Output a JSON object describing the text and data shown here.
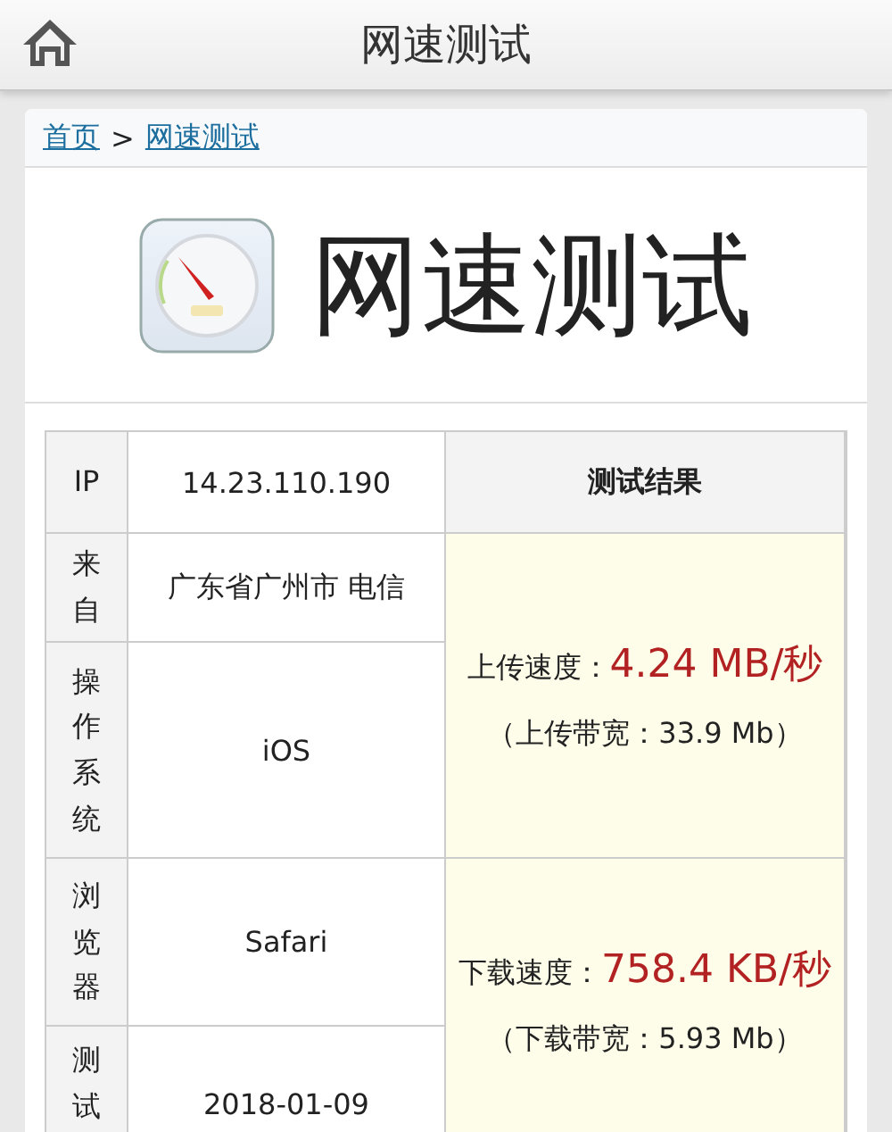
{
  "header": {
    "title": "网速测试"
  },
  "breadcrumb": {
    "links": [
      {
        "label": "首页"
      },
      {
        "label": "网速测试"
      }
    ],
    "separator": ">"
  },
  "hero": {
    "title": "网速测试"
  },
  "table": {
    "result_heading": "测试结果",
    "rows": [
      {
        "label": "IP",
        "value": "14.23.110.190"
      },
      {
        "label": "来自",
        "value": "广东省广州市 电信"
      },
      {
        "label": "操作系统",
        "value": "iOS"
      },
      {
        "label": "浏览器",
        "value": "Safari"
      },
      {
        "label": "测试",
        "value": "2018-01-09"
      }
    ],
    "results": [
      {
        "speed_label": "上传速度：",
        "speed": "4.24 MB/秒",
        "bandwidth": "（上传带宽：33.9 Mb）"
      },
      {
        "speed_label": "下载速度：",
        "speed": "758.4 KB/秒",
        "bandwidth": "（下载带宽：5.93 Mb）"
      }
    ]
  }
}
